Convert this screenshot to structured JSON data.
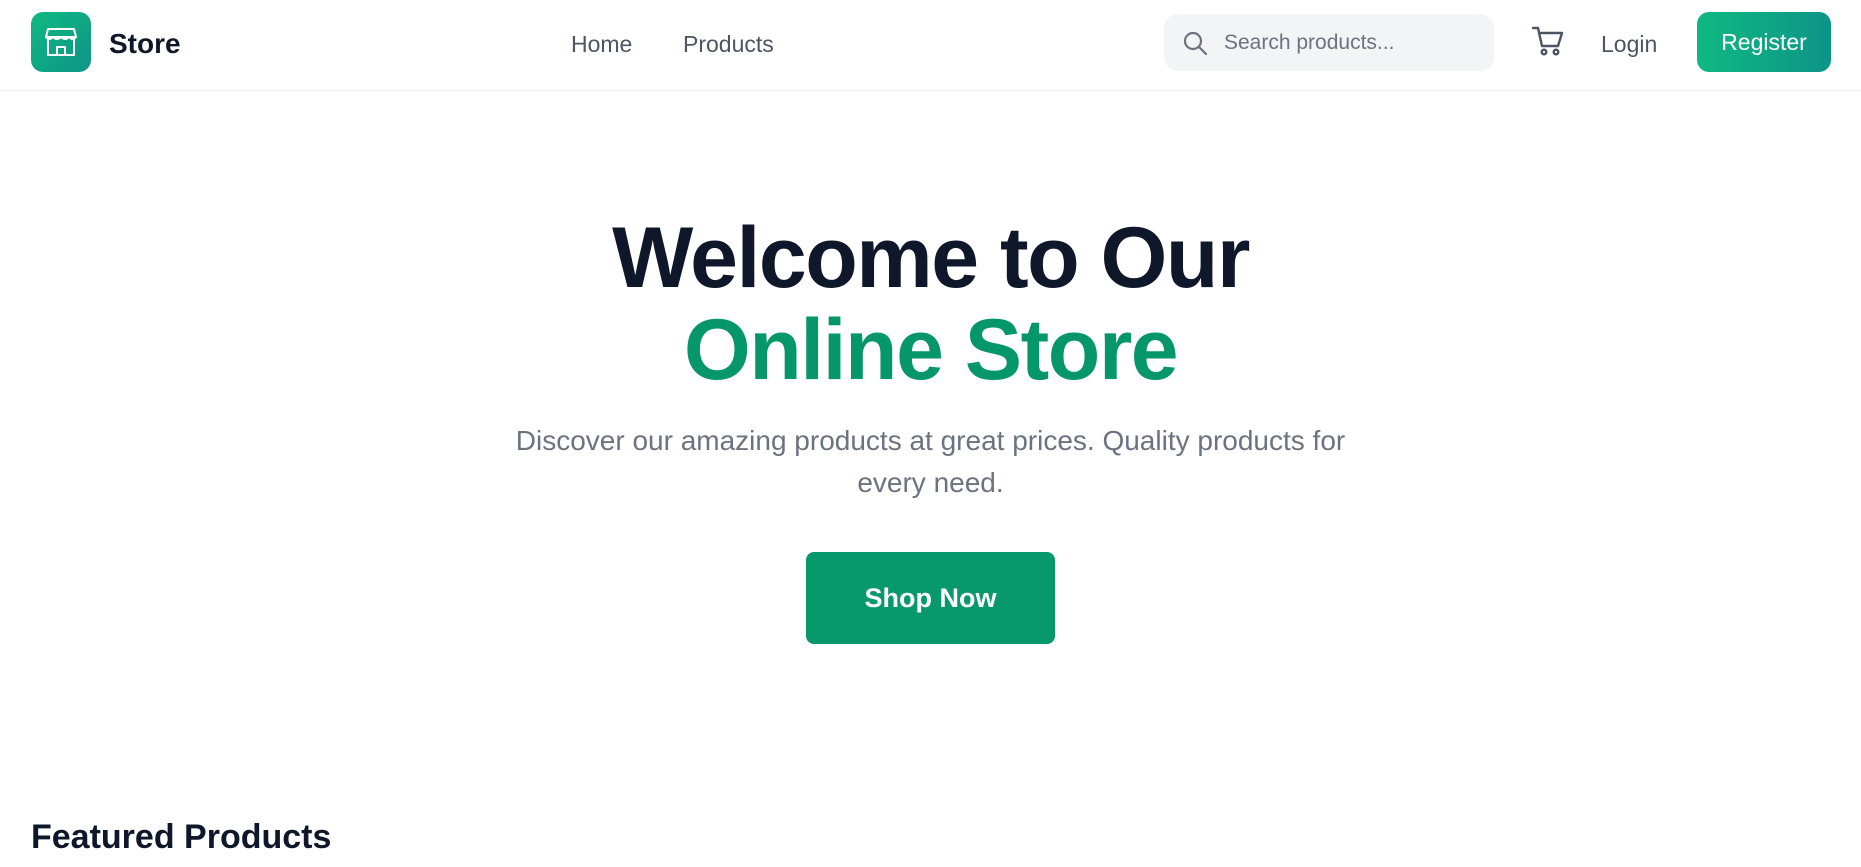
{
  "header": {
    "brand": {
      "name": "Store",
      "icon": "storefront-icon",
      "accent_from": "#10b981",
      "accent_to": "#0d9488"
    },
    "nav": [
      {
        "label": "Home"
      },
      {
        "label": "Products"
      }
    ],
    "search": {
      "placeholder": "Search products...",
      "value": "",
      "icon": "search-icon"
    },
    "cart": {
      "icon": "cart-icon"
    },
    "login_label": "Login",
    "register_label": "Register"
  },
  "hero": {
    "title_line1": "Welcome to Our",
    "title_line2": "Online Store",
    "subtitle": "Discover our amazing products at great prices. Quality products for every need.",
    "cta_label": "Shop Now",
    "accent_color": "#059669"
  },
  "featured": {
    "heading": "Featured Products"
  }
}
